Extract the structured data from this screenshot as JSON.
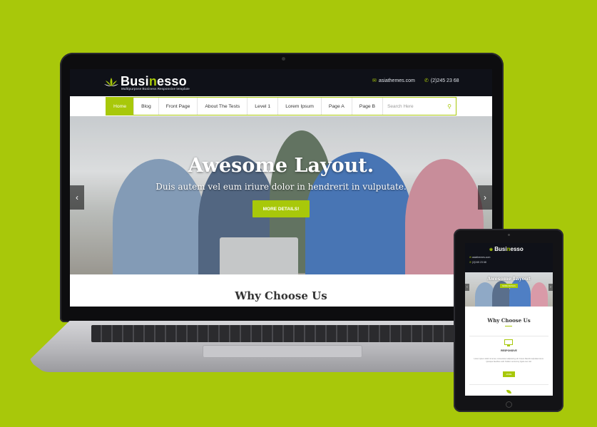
{
  "site": {
    "logo": {
      "name_prefix": "Busi",
      "name_highlight": "n",
      "name_suffix": "esso",
      "tagline": "Multipurpose Business Responsive template"
    },
    "contact": {
      "email": "asiathemes.com",
      "phone": "(2)245 23 68"
    },
    "nav": [
      "Home",
      "Blog",
      "Front Page",
      "About The Tests",
      "Level 1",
      "Lorem Ipsum",
      "Page A",
      "Page B"
    ],
    "search": {
      "placeholder": "Search Here"
    },
    "hero": {
      "title": "Awesome Layout.",
      "subtitle": "Duis autem vel eum iriure dolor in hendrerit in vulputate.",
      "button": "MORE DETAILS!",
      "prev": "‹",
      "next": "›"
    },
    "section_title": "Why Choose Us"
  },
  "tablet": {
    "logo": {
      "name_prefix": "Busi",
      "name_highlight": "n",
      "name_suffix": "esso"
    },
    "contact_email": "asiathemes.com",
    "contact_phone": "(2)245 23 68",
    "hero_title": "Awesome Layout",
    "hero_button": "MORE DETAILS",
    "section_title": "Why Choose Us",
    "feature_title": "RESPONSIVE",
    "feature_text": "Lorem ipsum dolor sit amet, consectetur adipiscing elit. Fusce blandit vulputate lorem. Quisque faucibus velit. Nullam nonummy ligula nec nisl.",
    "feature_button": "MORE"
  },
  "colors": {
    "accent": "#a8c80a",
    "header": "#0f1118",
    "background": "#a8c80a"
  },
  "icons": {
    "email": "envelope-icon",
    "phone": "phone-icon",
    "search": "search-icon",
    "logo": "lotus-icon"
  }
}
